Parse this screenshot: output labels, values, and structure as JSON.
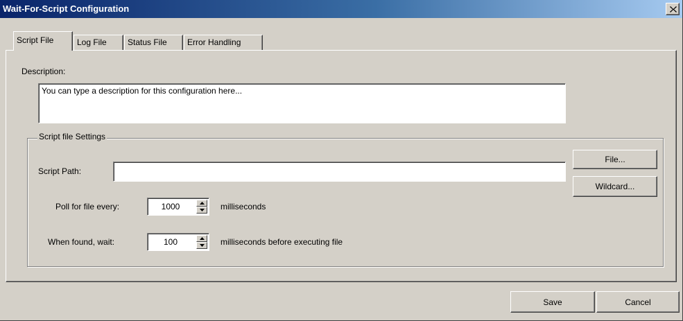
{
  "window": {
    "title": "Wait-For-Script Configuration"
  },
  "tabs": [
    {
      "label": "Script File",
      "active": true
    },
    {
      "label": "Log File",
      "active": false
    },
    {
      "label": "Status File",
      "active": false
    },
    {
      "label": "Error Handling",
      "active": false
    }
  ],
  "description": {
    "label": "Description:",
    "value": "You can type a description for this configuration here..."
  },
  "script_settings": {
    "group_label": "Script file Settings",
    "path_label": "Script Path:",
    "path_value": "",
    "file_button": "File...",
    "wildcard_button": "Wildcard...",
    "poll_label": "Poll for file every:",
    "poll_value": "1000",
    "poll_units": "milliseconds",
    "wait_label": "When found, wait:",
    "wait_value": "100",
    "wait_units": "milliseconds before executing file"
  },
  "footer": {
    "save_label": "Save",
    "cancel_label": "Cancel"
  },
  "colors": {
    "titlebar_start": "#0a246a",
    "titlebar_end": "#a6caf0",
    "face": "#d4d0c8"
  }
}
